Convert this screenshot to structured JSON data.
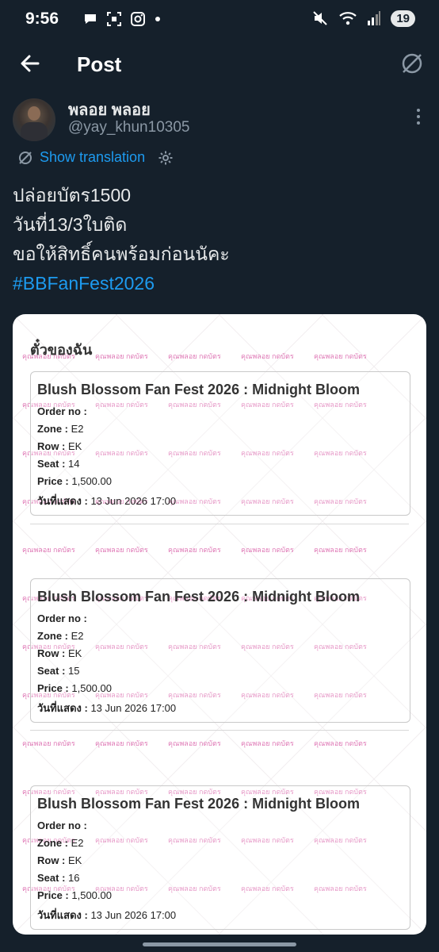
{
  "status_bar": {
    "time": "9:56",
    "left_icons": [
      "chat-bubble-icon",
      "screenshot-icon",
      "instagram-icon",
      "dot-icon"
    ],
    "right_icons": [
      "mute-icon",
      "wifi-icon",
      "signal-icon"
    ],
    "battery": "19"
  },
  "app_bar": {
    "title": "Post",
    "back_icon": "arrow-left-icon",
    "grok_icon": "grok-icon"
  },
  "post": {
    "display_name": "พลอย พลอย",
    "handle": "@yay_khun10305",
    "show_translation": "Show translation",
    "lines": [
      "ปล่อยบัตร1500",
      "วันที่13/3ใบติด",
      "ขอให้สิทธิ์คนพร้อมก่อนนัคะ"
    ],
    "hashtag": "#BBFanFest2026"
  },
  "media": {
    "header": "ตั๋วของฉัน",
    "watermark": "คุณพลอย กดบัตร",
    "tickets": [
      {
        "title": "Blush Blossom Fan Fest 2026 : Midnight Bloom",
        "order_label": "Order no :",
        "order_value": "",
        "zone_label": "Zone :",
        "zone_value": "E2",
        "row_label": "Row :",
        "row_value": "EK",
        "seat_label": "Seat :",
        "seat_value": "14",
        "price_label": "Price :",
        "price_value": "1,500.00",
        "date_label": "วันที่แสดง :",
        "date_value": "13 Jun 2026 17:00"
      },
      {
        "title": "Blush Blossom Fan Fest 2026 : Midnight Bloom",
        "order_label": "Order no :",
        "order_value": "",
        "zone_label": "Zone :",
        "zone_value": "E2",
        "row_label": "Row :",
        "row_value": "EK",
        "seat_label": "Seat :",
        "seat_value": "15",
        "price_label": "Price :",
        "price_value": "1,500.00",
        "date_label": "วันที่แสดง :",
        "date_value": "13 Jun 2026 17:00"
      },
      {
        "title": "Blush Blossom Fan Fest 2026 : Midnight Bloom",
        "order_label": "Order no :",
        "order_value": "",
        "zone_label": "Zone :",
        "zone_value": "E2",
        "row_label": "Row :",
        "row_value": "EK",
        "seat_label": "Seat :",
        "seat_value": "16",
        "price_label": "Price :",
        "price_value": "1,500.00",
        "date_label": "วันที่แสดง :",
        "date_value": "13 Jun 2026 17:00"
      }
    ]
  },
  "colors": {
    "background": "#15202b",
    "link": "#1d9bf0",
    "watermark": "#d95fa8"
  }
}
